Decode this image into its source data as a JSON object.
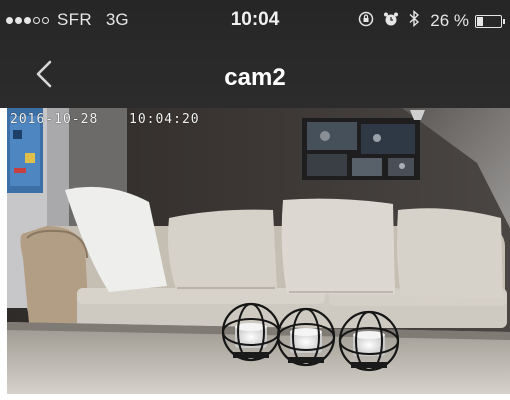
{
  "status_bar": {
    "signal_bars": 5,
    "signal_filled": 3,
    "carrier": "SFR",
    "network": "3G",
    "time": "10:04",
    "battery_percent_text": "26 %",
    "battery_level": 0.26,
    "icons": [
      "rotation-lock-icon",
      "alarm-icon",
      "bluetooth-icon"
    ]
  },
  "nav": {
    "back_icon": "chevron-left-icon",
    "title": "cam2"
  },
  "camera": {
    "date": "2016-10-28",
    "time": "10:04:20"
  },
  "colors": {
    "nav_bg": "#262626",
    "text": "#ffffff"
  }
}
